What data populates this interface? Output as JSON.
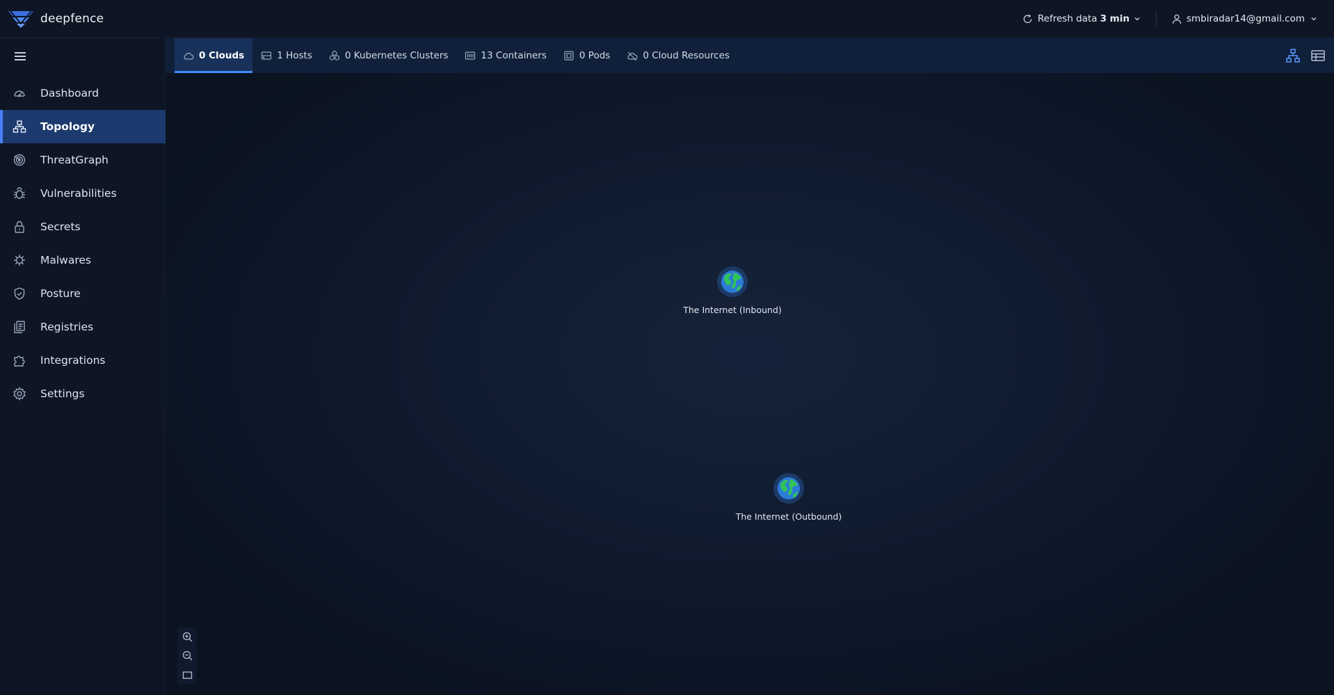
{
  "brand": {
    "name": "deepfence"
  },
  "header": {
    "refresh_label": "Refresh data",
    "refresh_interval": "3 min",
    "user_email": "smbiradar14@gmail.com"
  },
  "sidebar": {
    "items": [
      {
        "label": "Dashboard",
        "icon": "dashboard-icon",
        "active": false
      },
      {
        "label": "Topology",
        "icon": "topology-icon",
        "active": true
      },
      {
        "label": "ThreatGraph",
        "icon": "threatgraph-icon",
        "active": false
      },
      {
        "label": "Vulnerabilities",
        "icon": "bug-icon",
        "active": false
      },
      {
        "label": "Secrets",
        "icon": "lock-icon",
        "active": false
      },
      {
        "label": "Malwares",
        "icon": "virus-icon",
        "active": false
      },
      {
        "label": "Posture",
        "icon": "shield-icon",
        "active": false
      },
      {
        "label": "Registries",
        "icon": "registries-icon",
        "active": false
      },
      {
        "label": "Integrations",
        "icon": "puzzle-icon",
        "active": false
      },
      {
        "label": "Settings",
        "icon": "gear-icon",
        "active": false
      }
    ]
  },
  "tabs": [
    {
      "label": "0 Clouds",
      "icon": "cloud-icon",
      "active": true
    },
    {
      "label": "1 Hosts",
      "icon": "host-icon",
      "active": false
    },
    {
      "label": "0 Kubernetes Clusters",
      "icon": "kubernetes-icon",
      "active": false
    },
    {
      "label": "13 Containers",
      "icon": "container-icon",
      "active": false
    },
    {
      "label": "0 Pods",
      "icon": "pod-icon",
      "active": false
    },
    {
      "label": "0 Cloud Resources",
      "icon": "cloud-resources-icon",
      "active": false
    }
  ],
  "graph": {
    "nodes": [
      {
        "label": "The Internet (Inbound)",
        "icon": "globe-icon"
      },
      {
        "label": "The Internet (Outbound)",
        "icon": "globe-icon"
      }
    ]
  },
  "colors": {
    "accent": "#3f8cff",
    "sidebar_active": "#1c3a6e",
    "background": "#0b1321"
  }
}
